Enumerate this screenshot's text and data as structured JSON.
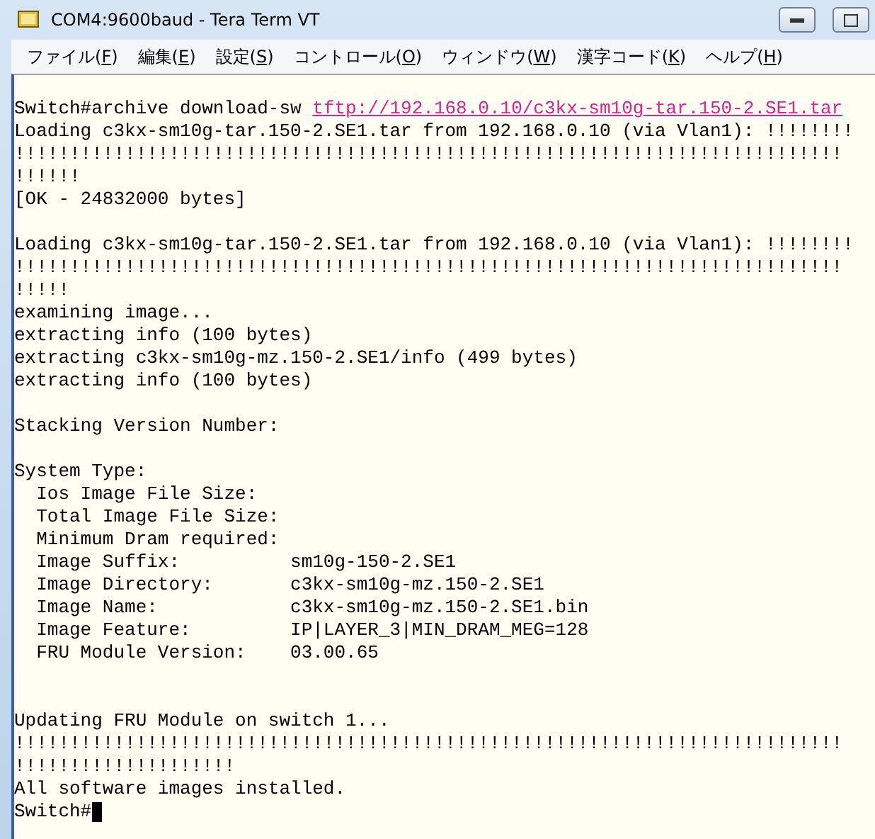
{
  "window": {
    "title": "COM4:9600baud - Tera Term VT"
  },
  "menu": [
    {
      "before": "ファイル(",
      "key": "F",
      "after": ")"
    },
    {
      "before": "編集(",
      "key": "E",
      "after": ")"
    },
    {
      "before": "設定(",
      "key": "S",
      "after": ")"
    },
    {
      "before": "コントロール(",
      "key": "O",
      "after": ")"
    },
    {
      "before": "ウィンドウ(",
      "key": "W",
      "after": ")"
    },
    {
      "before": "漢字コード(",
      "key": "K",
      "after": ")"
    },
    {
      "before": "ヘルプ(",
      "key": "H",
      "after": ")"
    }
  ],
  "terminal": {
    "cursor": true,
    "lines": [
      {
        "kind": "after_blank",
        "text": "Switch#archive download-sw ",
        "link": "tftp://192.168.0.10/c3kx-sm10g-tar.150-2.SE1.tar"
      },
      {
        "kind": "plain",
        "text": "Loading c3kx-sm10g-tar.150-2.SE1.tar from 192.168.0.10 (via Vlan1): !!!!!!!!"
      },
      {
        "kind": "plain",
        "text": "!!!!!!!!!!!!!!!!!!!!!!!!!!!!!!!!!!!!!!!!!!!!!!!!!!!!!!!!!!!!!!!!!!!!!!!!!!!"
      },
      {
        "kind": "plain",
        "text": "!!!!!!"
      },
      {
        "kind": "plain",
        "text": "[OK - 24832000 bytes]"
      },
      {
        "kind": "after_blank",
        "text": "Loading c3kx-sm10g-tar.150-2.SE1.tar from 192.168.0.10 (via Vlan1): !!!!!!!!"
      },
      {
        "kind": "plain",
        "text": "!!!!!!!!!!!!!!!!!!!!!!!!!!!!!!!!!!!!!!!!!!!!!!!!!!!!!!!!!!!!!!!!!!!!!!!!!!!"
      },
      {
        "kind": "plain",
        "text": "!!!!!"
      },
      {
        "kind": "plain",
        "text": "examining image..."
      },
      {
        "kind": "plain",
        "text": "extracting info (100 bytes)"
      },
      {
        "kind": "plain",
        "text": "extracting c3kx-sm10g-mz.150-2.SE1/info (499 bytes)"
      },
      {
        "kind": "plain",
        "text": "extracting info (100 bytes)"
      },
      {
        "kind": "after_blank",
        "text": "Stacking Version Number:"
      },
      {
        "kind": "after_blank",
        "text": "System Type:"
      },
      {
        "kind": "plain",
        "text": "  Ios Image File Size:"
      },
      {
        "kind": "plain",
        "text": "  Total Image File Size:"
      },
      {
        "kind": "plain",
        "text": "  Minimum Dram required:"
      },
      {
        "kind": "plain",
        "text": "  Image Suffix:          sm10g-150-2.SE1"
      },
      {
        "kind": "plain",
        "text": "  Image Directory:       c3kx-sm10g-mz.150-2.SE1"
      },
      {
        "kind": "plain",
        "text": "  Image Name:            c3kx-sm10g-mz.150-2.SE1.bin"
      },
      {
        "kind": "plain",
        "text": "  Image Feature:         IP|LAYER_3|MIN_DRAM_MEG=128"
      },
      {
        "kind": "plain",
        "text": "  FRU Module Version:    03.00.65"
      },
      {
        "kind": "after_two_blanks",
        "text": "Updating FRU Module on switch 1..."
      },
      {
        "kind": "plain",
        "text": "!!!!!!!!!!!!!!!!!!!!!!!!!!!!!!!!!!!!!!!!!!!!!!!!!!!!!!!!!!!!!!!!!!!!!!!!!!!"
      },
      {
        "kind": "plain",
        "text": "!!!!!!!!!!!!!!!!!!!!"
      },
      {
        "kind": "plain",
        "text": "All software images installed."
      },
      {
        "kind": "plain",
        "text": "Switch#"
      }
    ]
  }
}
